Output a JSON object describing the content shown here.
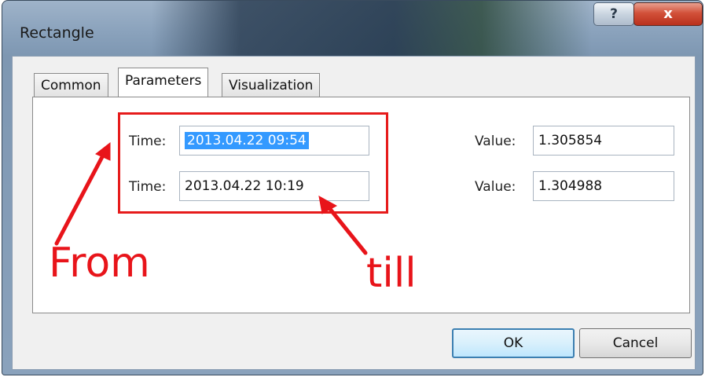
{
  "window": {
    "title": "Rectangle",
    "help_label": "?",
    "close_label": "x"
  },
  "tabs": [
    {
      "label": "Common"
    },
    {
      "label": "Parameters"
    },
    {
      "label": "Visualization"
    }
  ],
  "params": {
    "time_label": "Time:",
    "value_label": "Value:",
    "time1": "2013.04.22 09:54",
    "time2": "2013.04.22 10:19",
    "value1": "1.305854",
    "value2": "1.304988"
  },
  "annotations": {
    "from": "From",
    "till": "till",
    "color": "#e8141a"
  },
  "buttons": {
    "ok": "OK",
    "cancel": "Cancel"
  }
}
